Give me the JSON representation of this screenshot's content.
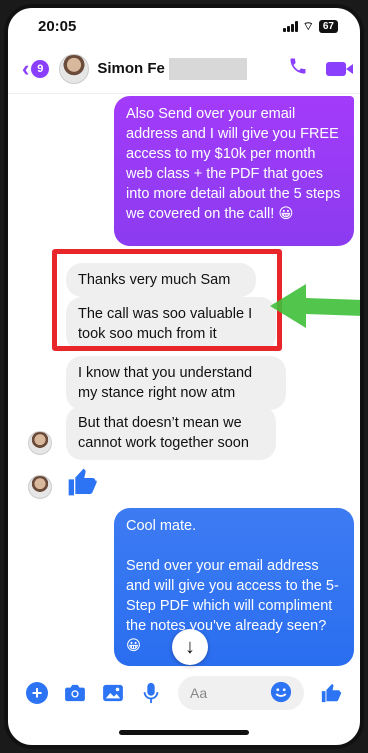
{
  "status": {
    "time": "20:05",
    "battery": "67"
  },
  "header": {
    "back_count": "9",
    "contact_name": "Simon Fe"
  },
  "messages": {
    "out1": "Also Send over your email address and I will give you FREE access to my $10k per month web class + the PDF that goes into more detail about the 5 steps we covered on the call! 😀",
    "in1": "Thanks very much Sam",
    "in2": "The call was soo valuable I took soo much from it",
    "in3": "I know that you understand my stance right now atm",
    "in4": "But that doesn’t mean we cannot work together soon",
    "out2": "Cool mate.\n\nSend over your email address and will give you access to the 5-Step PDF which will compliment the notes you've already seen? 😀"
  },
  "composer": {
    "placeholder": "Aa"
  },
  "colors": {
    "messenger_purple": "#8a3ffc",
    "messenger_blue": "#2c74f3",
    "annotation_red": "#e8262a",
    "annotation_green": "#3fbf3a"
  },
  "icons": [
    "back-chevron-icon",
    "phone-icon",
    "video-icon",
    "like-thumb-icon",
    "plus-icon",
    "camera-icon",
    "gallery-icon",
    "microphone-icon",
    "emoji-icon",
    "scroll-down-arrow-icon"
  ]
}
